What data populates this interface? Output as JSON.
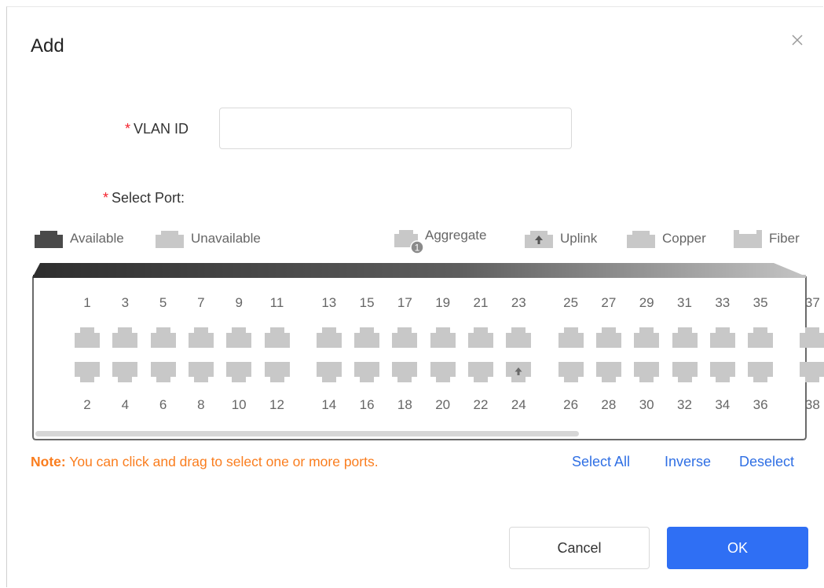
{
  "dialog": {
    "title": "Add",
    "close_icon": "close-icon"
  },
  "form": {
    "vlan_required_mark": "*",
    "vlan_label": "VLAN ID",
    "vlan_value": "",
    "vlan_placeholder": "",
    "port_required_mark": "*",
    "port_label": "Select Port:"
  },
  "legend": {
    "available": "Available",
    "unavailable": "Unavailable",
    "aggregate": "Aggregate",
    "aggregate_badge": "1",
    "uplink": "Uplink",
    "copper": "Copper",
    "fiber": "Fiber"
  },
  "ports": {
    "top": [
      "1",
      "3",
      "5",
      "7",
      "9",
      "11",
      "13",
      "15",
      "17",
      "19",
      "21",
      "23",
      "25",
      "27",
      "29",
      "31",
      "33",
      "35",
      "37"
    ],
    "bottom": [
      "2",
      "4",
      "6",
      "8",
      "10",
      "12",
      "14",
      "16",
      "18",
      "20",
      "22",
      "24",
      "26",
      "28",
      "30",
      "32",
      "34",
      "36",
      "38"
    ],
    "uplink_port": "24",
    "state": "unavailable"
  },
  "note": {
    "prefix": "Note:",
    "text": " You can click and drag to select one or more ports."
  },
  "actions": {
    "select_all": "Select All",
    "inverse": "Inverse",
    "deselect": "Deselect"
  },
  "buttons": {
    "cancel": "Cancel",
    "ok": "OK"
  },
  "colors": {
    "required": "#f5222d",
    "note": "#fa7d1e",
    "link": "#2f6fe4",
    "primary": "#2f6ff4",
    "port_unavailable": "#c8c8c8",
    "port_available": "#4a4a4a"
  }
}
